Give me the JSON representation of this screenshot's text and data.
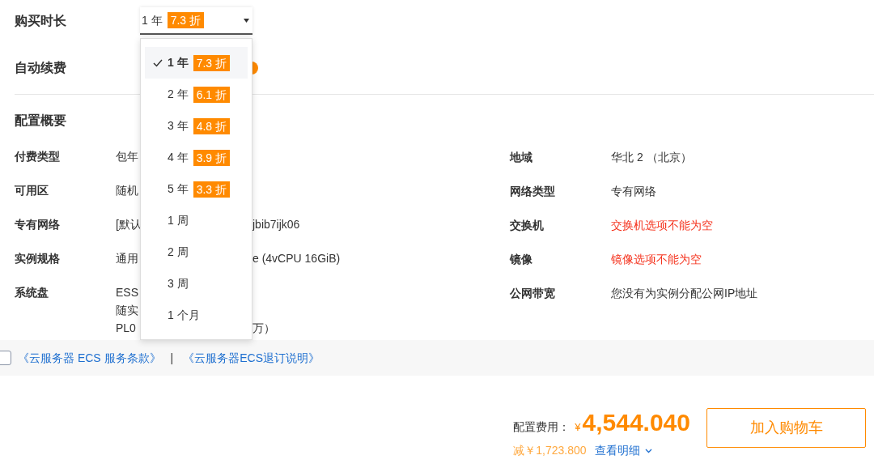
{
  "duration": {
    "label": "购买时长",
    "value": "1 年",
    "discount": "7.3 折"
  },
  "duration_menu": [
    {
      "label": "1 年",
      "discount": "7.3 折",
      "selected": true
    },
    {
      "label": "2 年",
      "discount": "6.1 折",
      "selected": false
    },
    {
      "label": "3 年",
      "discount": "4.8 折",
      "selected": false
    },
    {
      "label": "4 年",
      "discount": "3.9 折",
      "selected": false
    },
    {
      "label": "5 年",
      "discount": "3.3 折",
      "selected": false
    },
    {
      "label": "1 周",
      "selected": false
    },
    {
      "label": "2 周",
      "selected": false
    },
    {
      "label": "3 周",
      "selected": false
    },
    {
      "label": "1 个月",
      "selected": false
    }
  ],
  "auto_renew": {
    "label": "自动续费"
  },
  "summary": {
    "title": "配置概要",
    "left": [
      {
        "label": "付费类型",
        "lines": [
          {
            "before": "包年"
          }
        ]
      },
      {
        "label": "可用区",
        "lines": [
          {
            "before": "随机"
          }
        ]
      },
      {
        "label": "专有网络",
        "lines": [
          {
            "before": "[默认",
            "after": "jbib7ijk06"
          }
        ]
      },
      {
        "label": "实例规格",
        "lines": [
          {
            "before": "通用",
            "after": "e (4vCPU 16GiB)"
          }
        ]
      },
      {
        "label": "系统盘",
        "lines": [
          {
            "before": "ESS"
          },
          {
            "before": "随实"
          },
          {
            "before": "PL0",
            "after": "万）"
          }
        ]
      }
    ],
    "right": [
      {
        "label": "地域",
        "value": "华北 2 （北京）",
        "kind": "normal"
      },
      {
        "label": "网络类型",
        "value": "专有网络",
        "kind": "normal"
      },
      {
        "label": "交换机",
        "value": "交换机选项不能为空",
        "kind": "error"
      },
      {
        "label": "镜像",
        "value": "镜像选项不能为空",
        "kind": "error"
      },
      {
        "label": "公网带宽",
        "value": "您没有为实例分配公网IP地址",
        "kind": "normal"
      }
    ]
  },
  "agreement": {
    "checked": false,
    "links": [
      "《云服务器 ECS 服务条款》",
      "《云服务器ECS退订说明》"
    ],
    "separator": "|"
  },
  "price": {
    "label": "配置费用：",
    "currency": "¥",
    "amount": "4,544.040",
    "saving": "减￥1,723.800",
    "details_link": "查看明细",
    "button": "加入购物车"
  }
}
